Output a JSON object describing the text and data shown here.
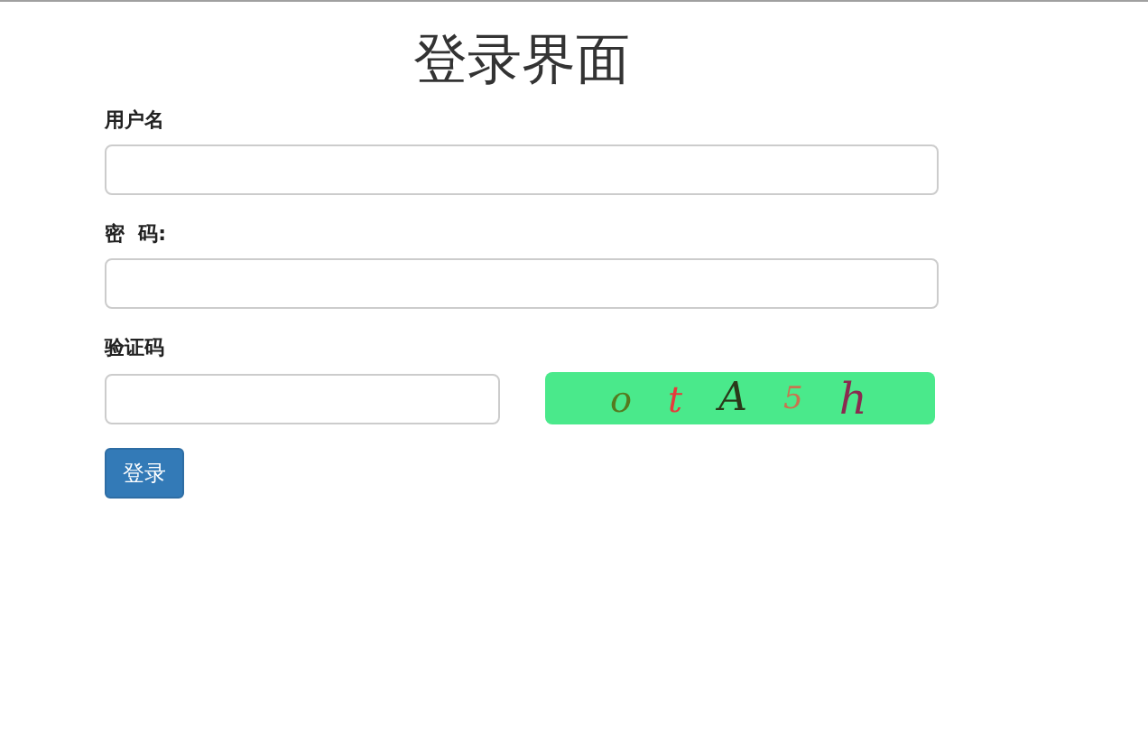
{
  "title": "登录界面",
  "fields": [
    {
      "label": "用户名"
    },
    {
      "label": "密  码:"
    }
  ],
  "captcha": {
    "label": "验证码",
    "chars": [
      {
        "text": "o",
        "color": "#557a1f"
      },
      {
        "text": "t",
        "color": "#e8393a"
      },
      {
        "text": "A",
        "color": "#2a3a1a"
      },
      {
        "text": "5",
        "color": "#c8744f"
      },
      {
        "text": "h",
        "color": "#8a2a50"
      }
    ]
  },
  "submit": "登录"
}
